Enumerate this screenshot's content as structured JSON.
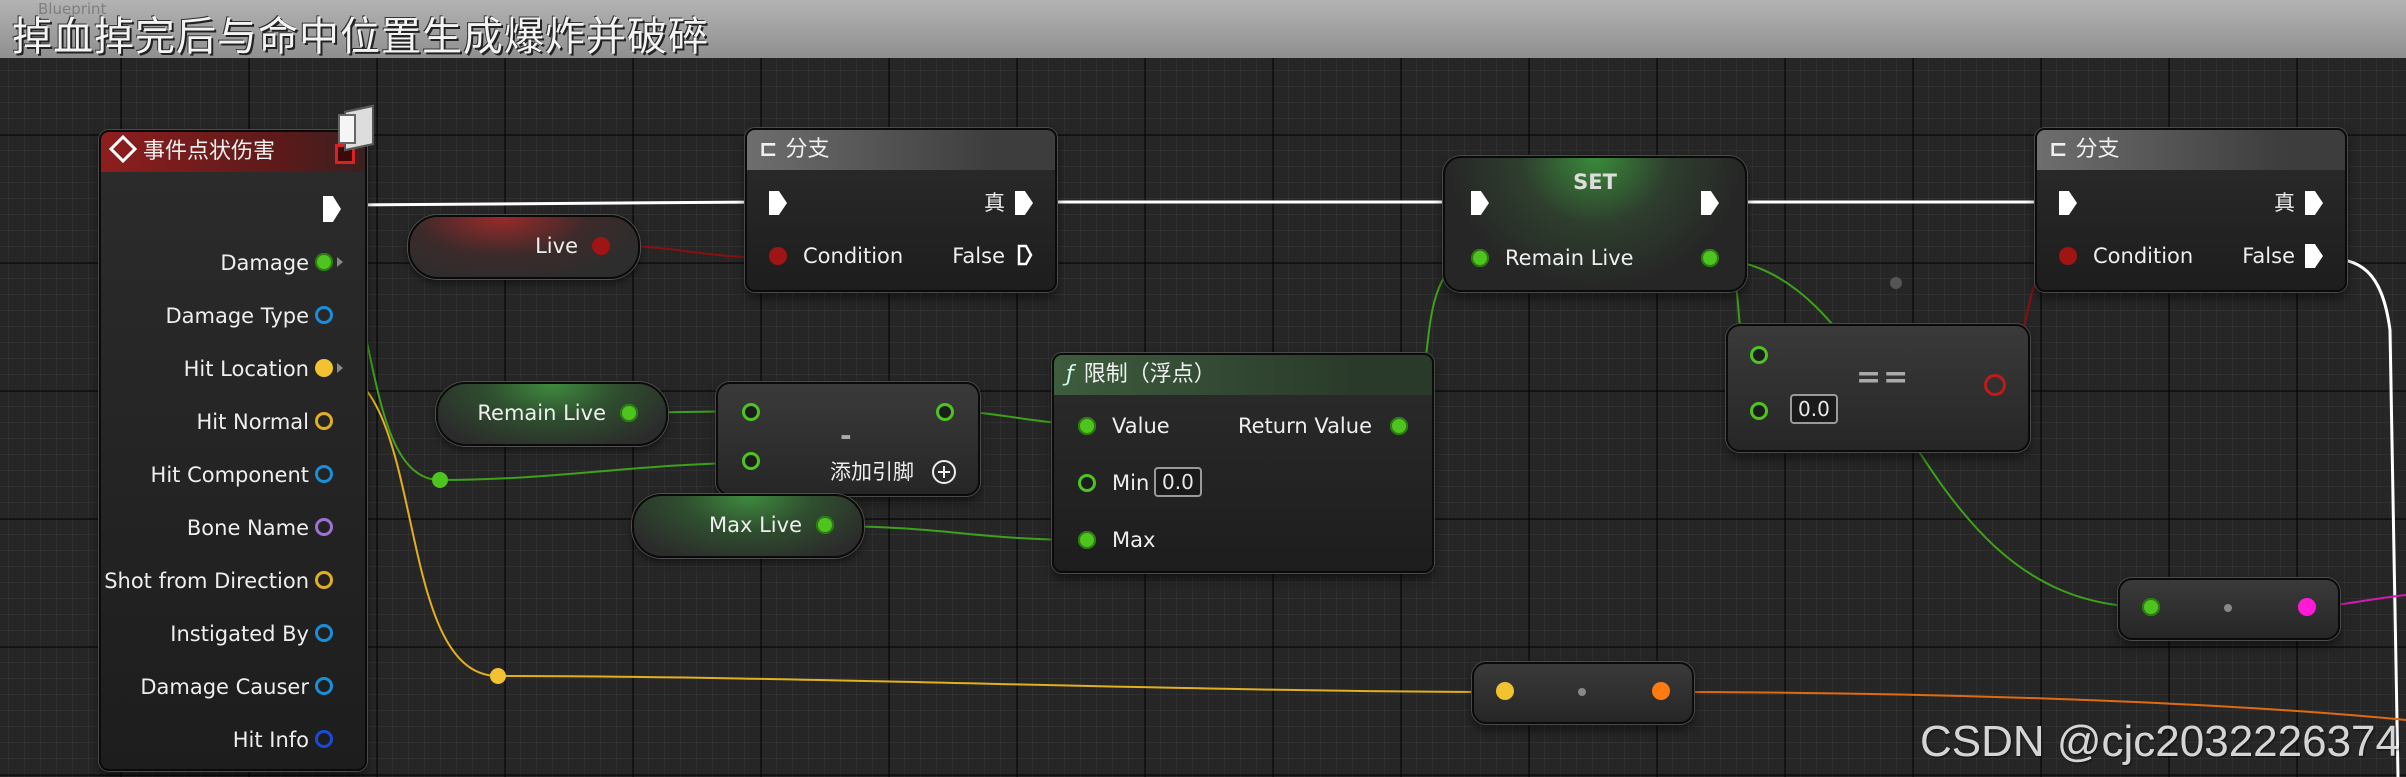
{
  "title": "掉血掉完后与命中位置生成爆炸并破碎",
  "title_ghost": "Blueprint",
  "event_node": {
    "header": "事件点状伤害",
    "pins": [
      "Damage",
      "Damage Type",
      "Hit Location",
      "Hit Normal",
      "Hit Component",
      "Bone Name",
      "Shot from Direction",
      "Instigated By",
      "Damage Causer",
      "Hit Info"
    ]
  },
  "branch1": {
    "header": "分支",
    "true_label": "真",
    "condition_label": "Condition",
    "false_label": "False"
  },
  "branch2": {
    "header": "分支",
    "true_label": "真",
    "condition_label": "Condition",
    "false_label": "False"
  },
  "live_var": "Live",
  "remain_live_var": "Remain Live",
  "max_live_var": "Max Live",
  "subtract_node": {
    "symbol": "-",
    "add_pin_label": "添加引脚"
  },
  "clamp_node": {
    "header": "限制（浮点）",
    "func_symbol": "ƒ",
    "value_label": "Value",
    "return_label": "Return Value",
    "min_label": "Min",
    "min_value": "0.0",
    "max_label": "Max"
  },
  "set_node": {
    "header": "SET",
    "pin_label": "Remain Live"
  },
  "equals_node": {
    "symbol": "==",
    "input_value": "0.0"
  },
  "watermark": "CSDN @cjc2032226374",
  "colors": {
    "exec": "#ffffff",
    "float": "#4ec41e",
    "bool": "#a01414",
    "vector": "#f2c230",
    "struct": "#1a8ed8",
    "name": "#a070d8",
    "orange": "#ff7a10",
    "magenta": "#ff1ad8"
  }
}
